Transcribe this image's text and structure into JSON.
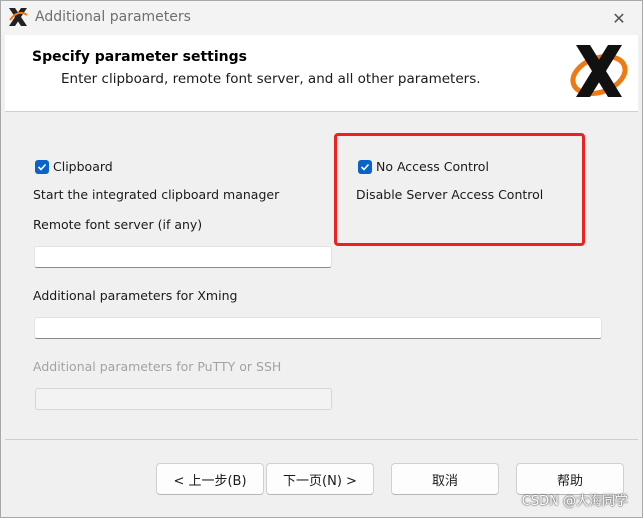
{
  "window": {
    "title": "Additional parameters",
    "close_glyph": "✕"
  },
  "header": {
    "title": "Specify parameter settings",
    "subtitle": "Enter clipboard, remote font server, and all other parameters."
  },
  "options": {
    "clipboard": {
      "label": "Clipboard",
      "checked": true,
      "description": "Start the integrated clipboard manager"
    },
    "no_access_control": {
      "label": "No Access Control",
      "checked": true,
      "description": "Disable Server Access Control"
    }
  },
  "fields": {
    "font_server": {
      "label": "Remote font server (if any)",
      "value": ""
    },
    "xming_params": {
      "label": "Additional parameters for Xming",
      "value": ""
    },
    "putty_params": {
      "label": "Additional parameters for PuTTY or SSH",
      "value": "",
      "disabled": true
    }
  },
  "buttons": {
    "back": "< 上一步(B)",
    "next": "下一页(N) >",
    "cancel": "取消",
    "help": "帮助"
  },
  "watermark": "CSDN @大海同学",
  "colors": {
    "checkbox": "#0a63c9",
    "highlight": "#f02020",
    "logo_orange": "#f07a12"
  }
}
